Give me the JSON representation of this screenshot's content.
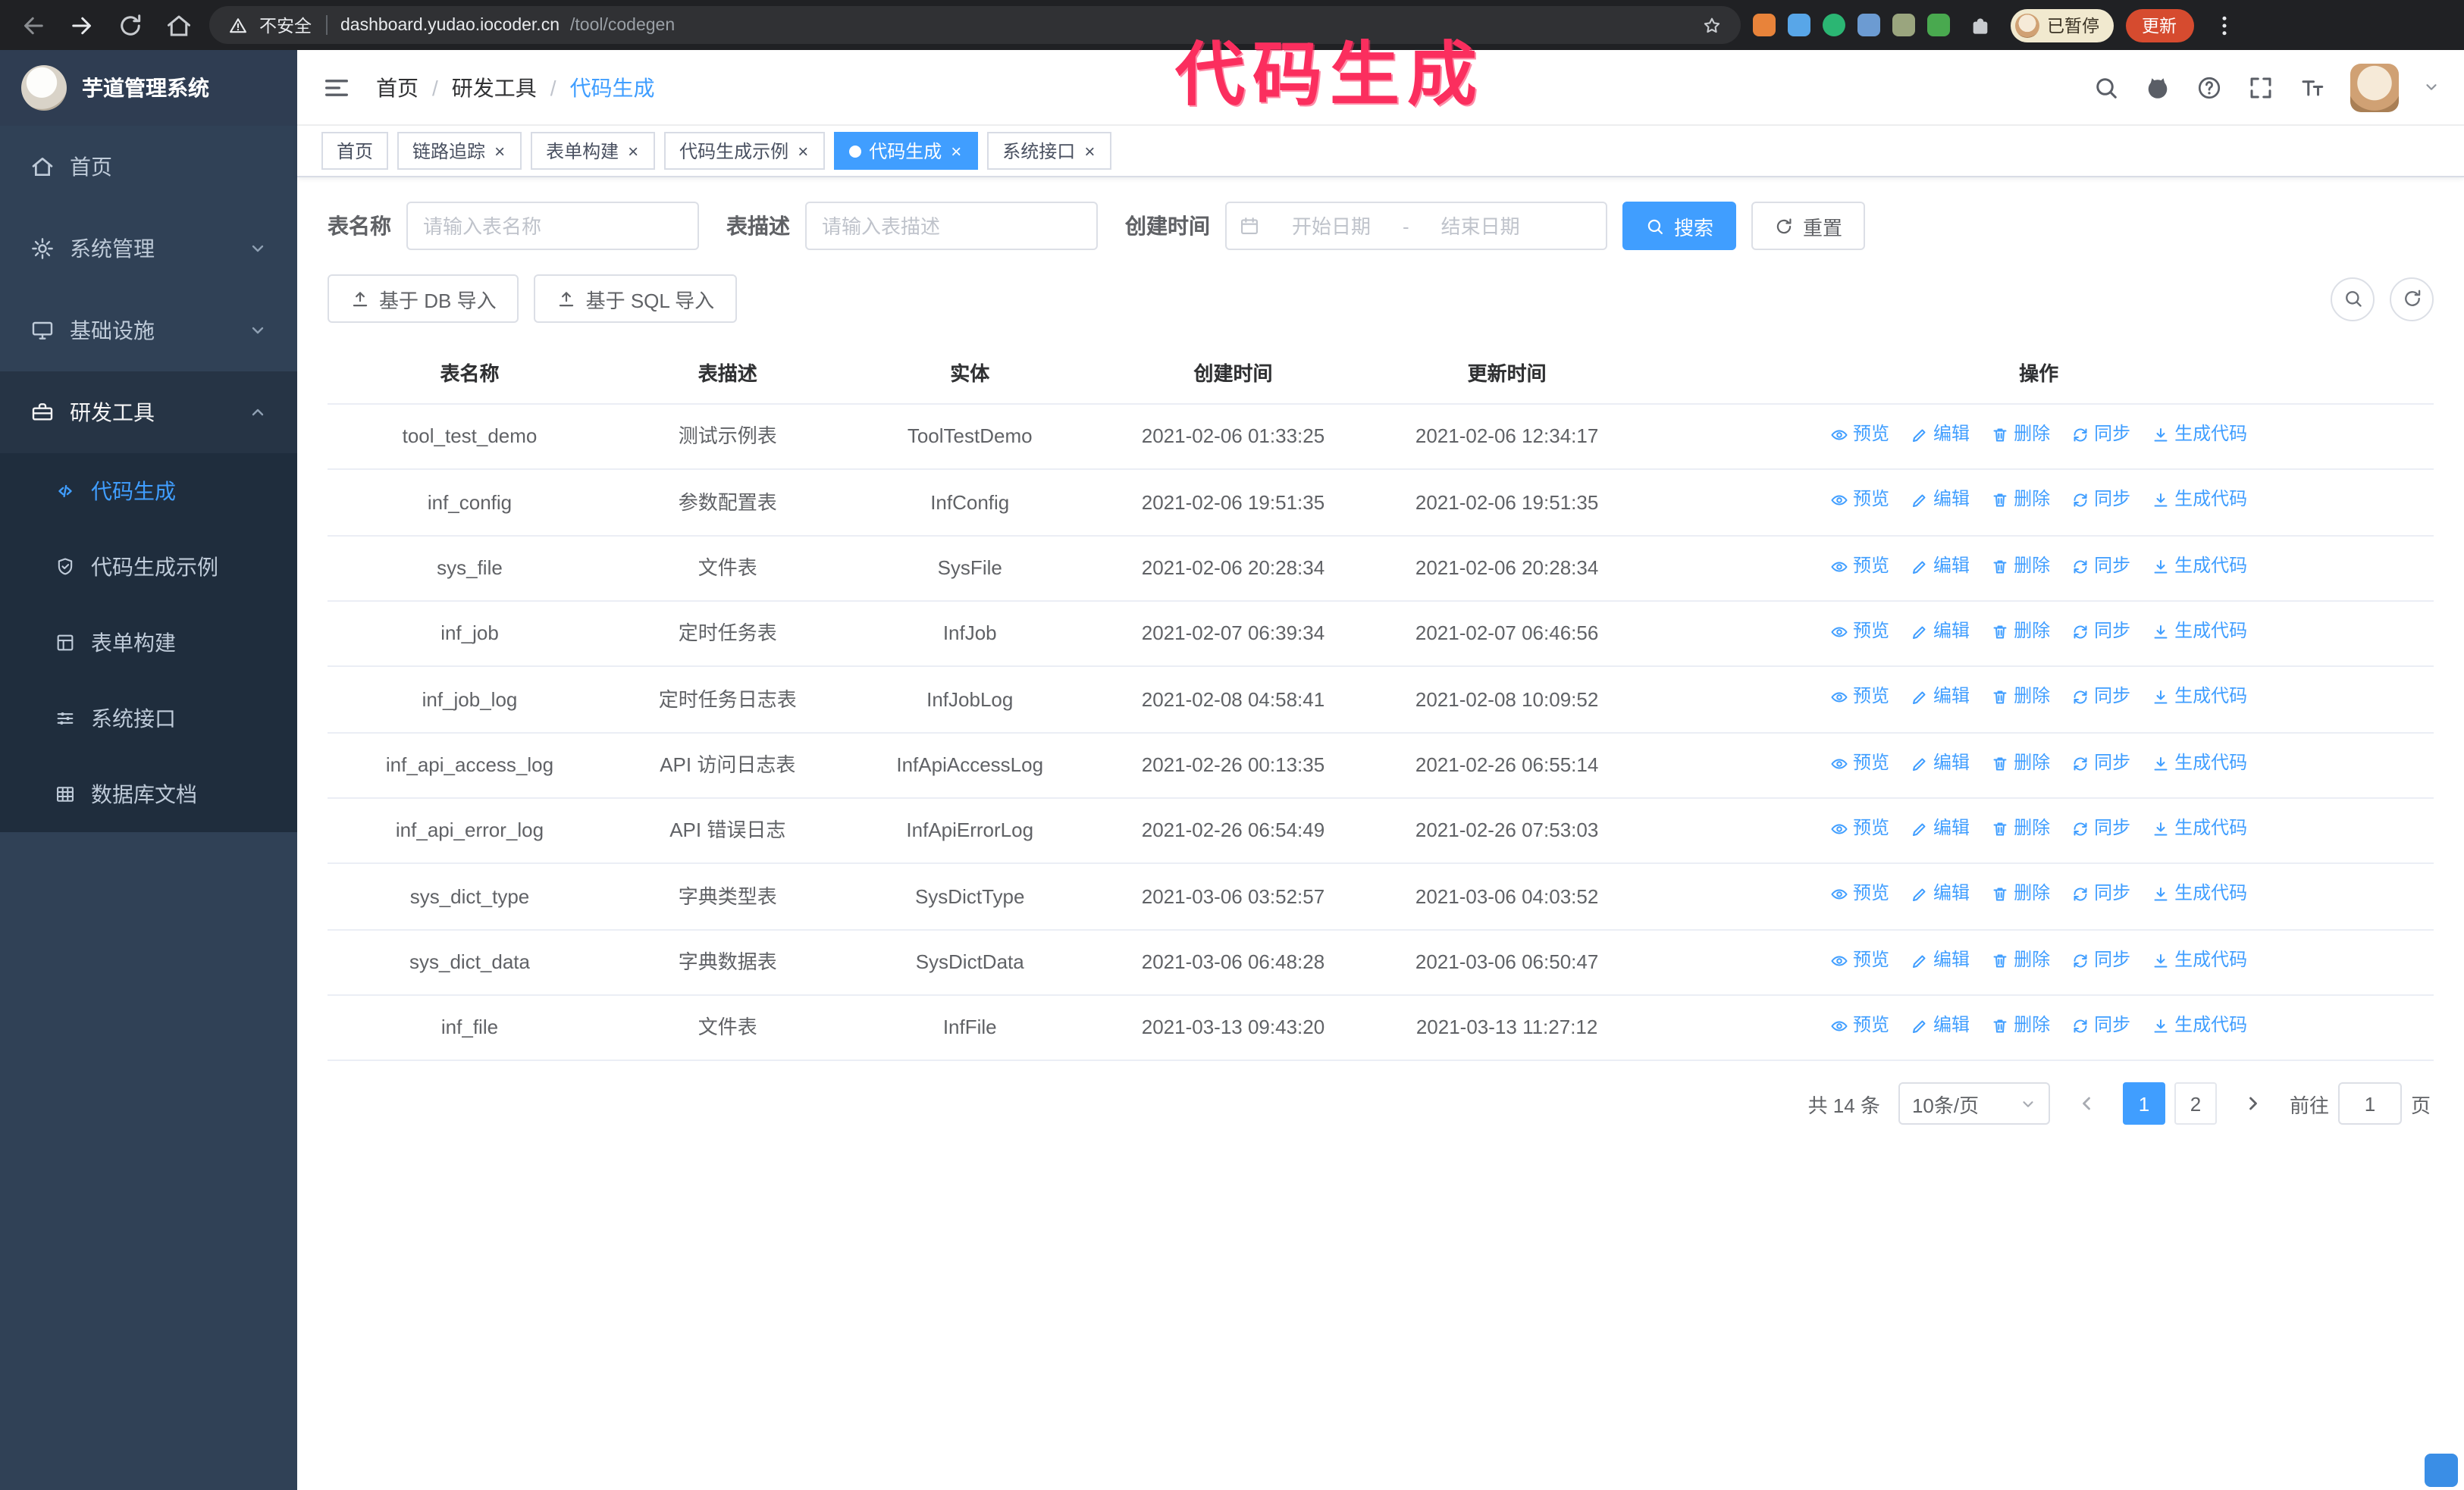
{
  "theme": {
    "accent": "#409eff",
    "sidebar_bg": "#304156",
    "submenu_bg": "#1f2d3d",
    "annotation_color": "#fb2e5e"
  },
  "annotation": {
    "text": "代码生成"
  },
  "chrome": {
    "security_label": "不安全",
    "url_host": "dashboard.yudao.iocoder.cn",
    "url_path": "/tool/codegen",
    "profile_chip": "已暂停",
    "update_button": "更新",
    "extensions": [
      {
        "name": "extension-orange-icon",
        "color": "#e8833a",
        "shape": "square"
      },
      {
        "name": "extension-blue-icon",
        "color": "#58a6e8",
        "shape": "square"
      },
      {
        "name": "extension-green-circle-icon",
        "color": "#2bb673",
        "shape": "circle"
      },
      {
        "name": "extension-people-icon",
        "color": "#6c9bd2",
        "shape": "square"
      },
      {
        "name": "extension-card-icon",
        "color": "#9aa57e",
        "shape": "square"
      },
      {
        "name": "extension-leaf-icon",
        "color": "#49a94f",
        "shape": "square"
      }
    ]
  },
  "sidebar": {
    "logo_title": "芋道管理系统",
    "menu": [
      {
        "key": "home",
        "label": "首页",
        "icon": "home",
        "expanded": false
      },
      {
        "key": "system",
        "label": "系统管理",
        "icon": "gear",
        "expanded": false,
        "group": true
      },
      {
        "key": "infra",
        "label": "基础设施",
        "icon": "infra",
        "expanded": false,
        "group": true
      },
      {
        "key": "devtool",
        "label": "研发工具",
        "icon": "tool",
        "expanded": true,
        "group": true,
        "children": [
          {
            "key": "codegen",
            "label": "代码生成",
            "icon": "code",
            "active": true
          },
          {
            "key": "codegen-example",
            "label": "代码生成示例",
            "icon": "shield",
            "active": false
          },
          {
            "key": "form-builder",
            "label": "表单构建",
            "icon": "form",
            "active": false
          },
          {
            "key": "system-api",
            "label": "系统接口",
            "icon": "api",
            "active": false
          },
          {
            "key": "db-doc",
            "label": "数据库文档",
            "icon": "db",
            "active": false
          }
        ]
      }
    ]
  },
  "navbar": {
    "breadcrumb": [
      "首页",
      "研发工具",
      "代码生成"
    ]
  },
  "tags": [
    {
      "label": "首页",
      "closable": false,
      "active": false
    },
    {
      "label": "链路追踪",
      "closable": true,
      "active": false
    },
    {
      "label": "表单构建",
      "closable": true,
      "active": false
    },
    {
      "label": "代码生成示例",
      "closable": true,
      "active": false
    },
    {
      "label": "代码生成",
      "closable": true,
      "active": true
    },
    {
      "label": "系统接口",
      "closable": true,
      "active": false
    }
  ],
  "filter": {
    "table_name_label": "表名称",
    "table_name_placeholder": "请输入表名称",
    "table_desc_label": "表描述",
    "table_desc_placeholder": "请输入表描述",
    "create_time_label": "创建时间",
    "date_start_placeholder": "开始日期",
    "date_separator": "-",
    "date_end_placeholder": "结束日期",
    "search_button": "搜索",
    "reset_button": "重置"
  },
  "toolbar": {
    "import_db_button": "基于 DB 导入",
    "import_sql_button": "基于 SQL 导入"
  },
  "table": {
    "columns": [
      "表名称",
      "表描述",
      "实体",
      "创建时间",
      "更新时间",
      "操作"
    ],
    "actions": [
      {
        "key": "preview",
        "label": "预览",
        "icon": "eye"
      },
      {
        "key": "edit",
        "label": "编辑",
        "icon": "edit"
      },
      {
        "key": "delete",
        "label": "删除",
        "icon": "del"
      },
      {
        "key": "sync",
        "label": "同步",
        "icon": "sync"
      },
      {
        "key": "generate",
        "label": "生成代码",
        "icon": "download"
      }
    ],
    "rows": [
      {
        "name": "tool_test_demo",
        "desc": "测试示例表",
        "entity": "ToolTestDemo",
        "created": "2021-02-06 01:33:25",
        "updated": "2021-02-06 12:34:17"
      },
      {
        "name": "inf_config",
        "desc": "参数配置表",
        "entity": "InfConfig",
        "created": "2021-02-06 19:51:35",
        "updated": "2021-02-06 19:51:35"
      },
      {
        "name": "sys_file",
        "desc": "文件表",
        "entity": "SysFile",
        "created": "2021-02-06 20:28:34",
        "updated": "2021-02-06 20:28:34"
      },
      {
        "name": "inf_job",
        "desc": "定时任务表",
        "entity": "InfJob",
        "created": "2021-02-07 06:39:34",
        "updated": "2021-02-07 06:46:56"
      },
      {
        "name": "inf_job_log",
        "desc": "定时任务日志表",
        "entity": "InfJobLog",
        "created": "2021-02-08 04:58:41",
        "updated": "2021-02-08 10:09:52"
      },
      {
        "name": "inf_api_access_log",
        "desc": "API 访问日志表",
        "entity": "InfApiAccessLog",
        "created": "2021-02-26 00:13:35",
        "updated": "2021-02-26 06:55:14"
      },
      {
        "name": "inf_api_error_log",
        "desc": "API 错误日志",
        "entity": "InfApiErrorLog",
        "created": "2021-02-26 06:54:49",
        "updated": "2021-02-26 07:53:03"
      },
      {
        "name": "sys_dict_type",
        "desc": "字典类型表",
        "entity": "SysDictType",
        "created": "2021-03-06 03:52:57",
        "updated": "2021-03-06 04:03:52"
      },
      {
        "name": "sys_dict_data",
        "desc": "字典数据表",
        "entity": "SysDictData",
        "created": "2021-03-06 06:48:28",
        "updated": "2021-03-06 06:50:47"
      },
      {
        "name": "inf_file",
        "desc": "文件表",
        "entity": "InfFile",
        "created": "2021-03-13 09:43:20",
        "updated": "2021-03-13 11:27:12"
      }
    ]
  },
  "pagination": {
    "total_text": "共 14 条",
    "page_size": "10条/页",
    "pages": [
      "1",
      "2"
    ],
    "active_page": "1",
    "goto_label": "前往",
    "goto_value": "1",
    "goto_suffix": "页"
  }
}
